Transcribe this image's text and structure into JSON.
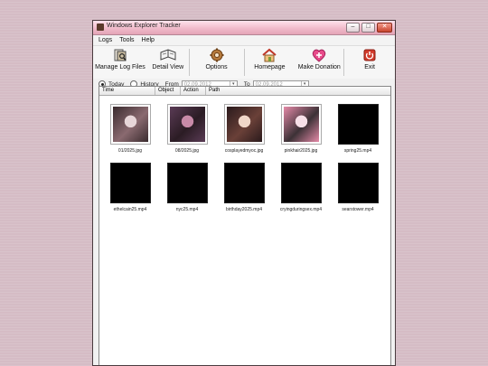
{
  "window": {
    "title": "Windows Explorer Tracker"
  },
  "menu": [
    "Logs",
    "Tools",
    "Help"
  ],
  "toolbar": [
    {
      "label": "Manage Log Files",
      "icon": "log-files-icon"
    },
    {
      "label": "Detail View",
      "icon": "detail-view-icon"
    },
    {
      "label": "Options",
      "icon": "options-gear-icon"
    },
    {
      "label": "Homepage",
      "icon": "home-icon"
    },
    {
      "label": "Make Donation",
      "icon": "heart-plus-icon"
    },
    {
      "label": "Exit",
      "icon": "exit-icon"
    }
  ],
  "filter": {
    "today": "Today",
    "history": "History",
    "from": "From",
    "from_value": "02.09.2012",
    "to": "To",
    "to_value": "02.09.2012",
    "selected": "Today"
  },
  "columns": [
    "Time",
    "Object",
    "Action",
    "Path"
  ],
  "files": [
    {
      "name": "01/2025.jpg",
      "type": "image",
      "colors": [
        "#3a2b2e",
        "#e7d6d8",
        "#8a6a70"
      ]
    },
    {
      "name": "08/2025.jpg",
      "type": "image",
      "colors": [
        "#5a3b55",
        "#c88aa8",
        "#2b1c24"
      ]
    },
    {
      "name": "cosplayedmyoc.jpg",
      "type": "image",
      "colors": [
        "#2a1a1c",
        "#f0d6c8",
        "#6a4038"
      ]
    },
    {
      "name": "pinkhair2025.jpg",
      "type": "image",
      "colors": [
        "#e58aa8",
        "#f7e0e8",
        "#3c3136"
      ]
    },
    {
      "name": "spring25.mp4",
      "type": "video",
      "colors": []
    },
    {
      "name": "ethelcain25.mp4",
      "type": "video",
      "colors": []
    },
    {
      "name": "nyc25.mp4",
      "type": "video",
      "colors": []
    },
    {
      "name": "birthday2025.mp4",
      "type": "video",
      "colors": []
    },
    {
      "name": "cryingduringsex.mp4",
      "type": "video",
      "colors": []
    },
    {
      "name": "searstower.mp4",
      "type": "video",
      "colors": []
    }
  ]
}
